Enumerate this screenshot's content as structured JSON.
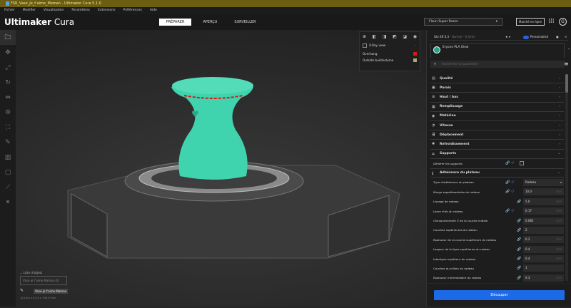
{
  "window": {
    "title": "FSR_Vase_Je_t'aime_Maman - Ultimaker Cura 5.1.0"
  },
  "menu": [
    "Fichier",
    "Modifier",
    "Visualisation",
    "Paramètres",
    "Extensions",
    "Préférences",
    "Aide"
  ],
  "header": {
    "logo_bold": "Ultimaker",
    "logo_light": " Cura",
    "stages": [
      "PRÉPARER",
      "APERÇU",
      "SURVEILLER"
    ],
    "printer": "Flsun Super Racer",
    "marketplace": "Marché en ligne",
    "avatar": "G",
    "apps_icon": "⋮⋮⋮"
  },
  "view_panel": {
    "xray": "X-Ray view",
    "overhang": "Overhang",
    "outside": "Outside buildvolume",
    "colors": {
      "overhang": "#e01515",
      "outside": "#a8a878"
    }
  },
  "profile": {
    "name": "Gtz SR 0.3",
    "quality": "- Normal - 0.3mm",
    "mode": "Personnalisé"
  },
  "material": "Eryone PLA Glow",
  "search_placeholder": "Rechercher un paramètre",
  "categories": [
    {
      "label": "Qualité",
      "icon": "▤"
    },
    {
      "label": "Parois",
      "icon": "▣"
    },
    {
      "label": "Haut / bas",
      "icon": "☰"
    },
    {
      "label": "Remplissage",
      "icon": "▦"
    },
    {
      "label": "Matériau",
      "icon": "◉"
    },
    {
      "label": "Vitesse",
      "icon": "◔"
    },
    {
      "label": "Déplacement",
      "icon": "⇶"
    },
    {
      "label": "Refroidissement",
      "icon": "✱"
    },
    {
      "label": "Supports",
      "icon": "⌂"
    }
  ],
  "supports_setting": "Générer les supports",
  "adhesion": {
    "label": "Adhérence du plateau",
    "icon": "⤓"
  },
  "settings": [
    {
      "label": "Type d'adhérence du plateau",
      "value": "Radeau",
      "unit": "",
      "italic": true,
      "reset": true
    },
    {
      "label": "Marge supplémentaire du radeau",
      "value": "10.0",
      "unit": "mm",
      "italic": true,
      "reset": true
    },
    {
      "label": "Lissage de radeau",
      "value": "5.0",
      "unit": "mm",
      "italic": false,
      "reset": false
    },
    {
      "label": "Lame d'air du radeau",
      "value": "0.17",
      "unit": "mm",
      "italic": true,
      "reset": true
    },
    {
      "label": "Chevauchement Z de la couche initiale",
      "value": "0.085",
      "unit": "mm",
      "italic": false,
      "reset": false
    },
    {
      "label": "Couches supérieures du radeau",
      "value": "2",
      "unit": "",
      "italic": false,
      "reset": false
    },
    {
      "label": "Épaisseur de la couche supérieure du radeau",
      "value": "0.2",
      "unit": "mm",
      "italic": false,
      "reset": false
    },
    {
      "label": "Largeur de la ligne supérieure du radeau",
      "value": "0.4",
      "unit": "mm",
      "italic": false,
      "reset": false
    },
    {
      "label": "Interligne supérieur du radeau",
      "value": "0.4",
      "unit": "mm",
      "italic": false,
      "reset": false
    },
    {
      "label": "Couches du milieu du radeau",
      "value": "1",
      "unit": "",
      "italic": false,
      "reset": false
    },
    {
      "label": "Épaisseur intermédiaire du radeau",
      "value": "0.3",
      "unit": "mm",
      "italic": false,
      "reset": false
    }
  ],
  "slice_button": "Découper",
  "objects": {
    "title": "Liste d'objets",
    "search_value": "Vase je t'aime Maman.stl",
    "selected": "Vase je t'aime Maman",
    "dims": "121.8 x 123.4 x 154.0 mm"
  }
}
